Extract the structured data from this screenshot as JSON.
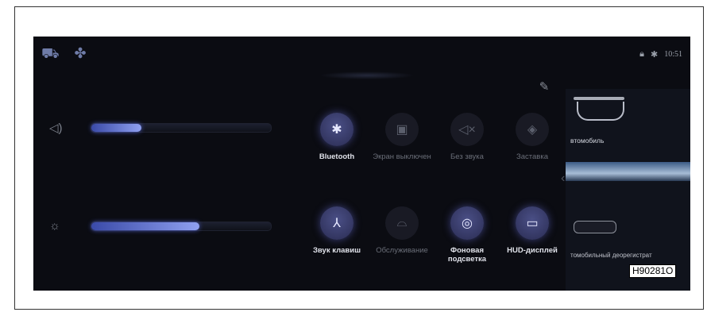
{
  "status": {
    "left_icons": [
      "seat-icon",
      "fan-icon"
    ],
    "right_icons": [
      "lock-icon",
      "bluetooth-icon"
    ],
    "time": "10:51"
  },
  "sliders": [
    {
      "icon": "volume-icon",
      "level": 0.28
    },
    {
      "icon": "brightness-icon",
      "level": 0.6
    }
  ],
  "tiles": [
    {
      "label": "Bluetooth",
      "icon": "bluetooth-icon",
      "active": true
    },
    {
      "label": "Экран выключен",
      "icon": "screen-off-icon",
      "active": false
    },
    {
      "label": "Без звука",
      "icon": "mute-icon",
      "active": false
    },
    {
      "label": "Заставка",
      "icon": "screensaver-icon",
      "active": false
    },
    {
      "label": "Звук клавиш",
      "icon": "key-sound-icon",
      "active": true
    },
    {
      "label": "Обслуживание",
      "icon": "service-icon",
      "active": false
    },
    {
      "label": "Фоновая подсветка",
      "icon": "backlight-icon",
      "active": true
    },
    {
      "label": "HUD-дисплей",
      "icon": "hud-icon",
      "active": true
    }
  ],
  "side_panel": {
    "item1_label": "втомобиль",
    "item2_label": "томобильный деорегистрат"
  },
  "figure_code": "H90281O"
}
